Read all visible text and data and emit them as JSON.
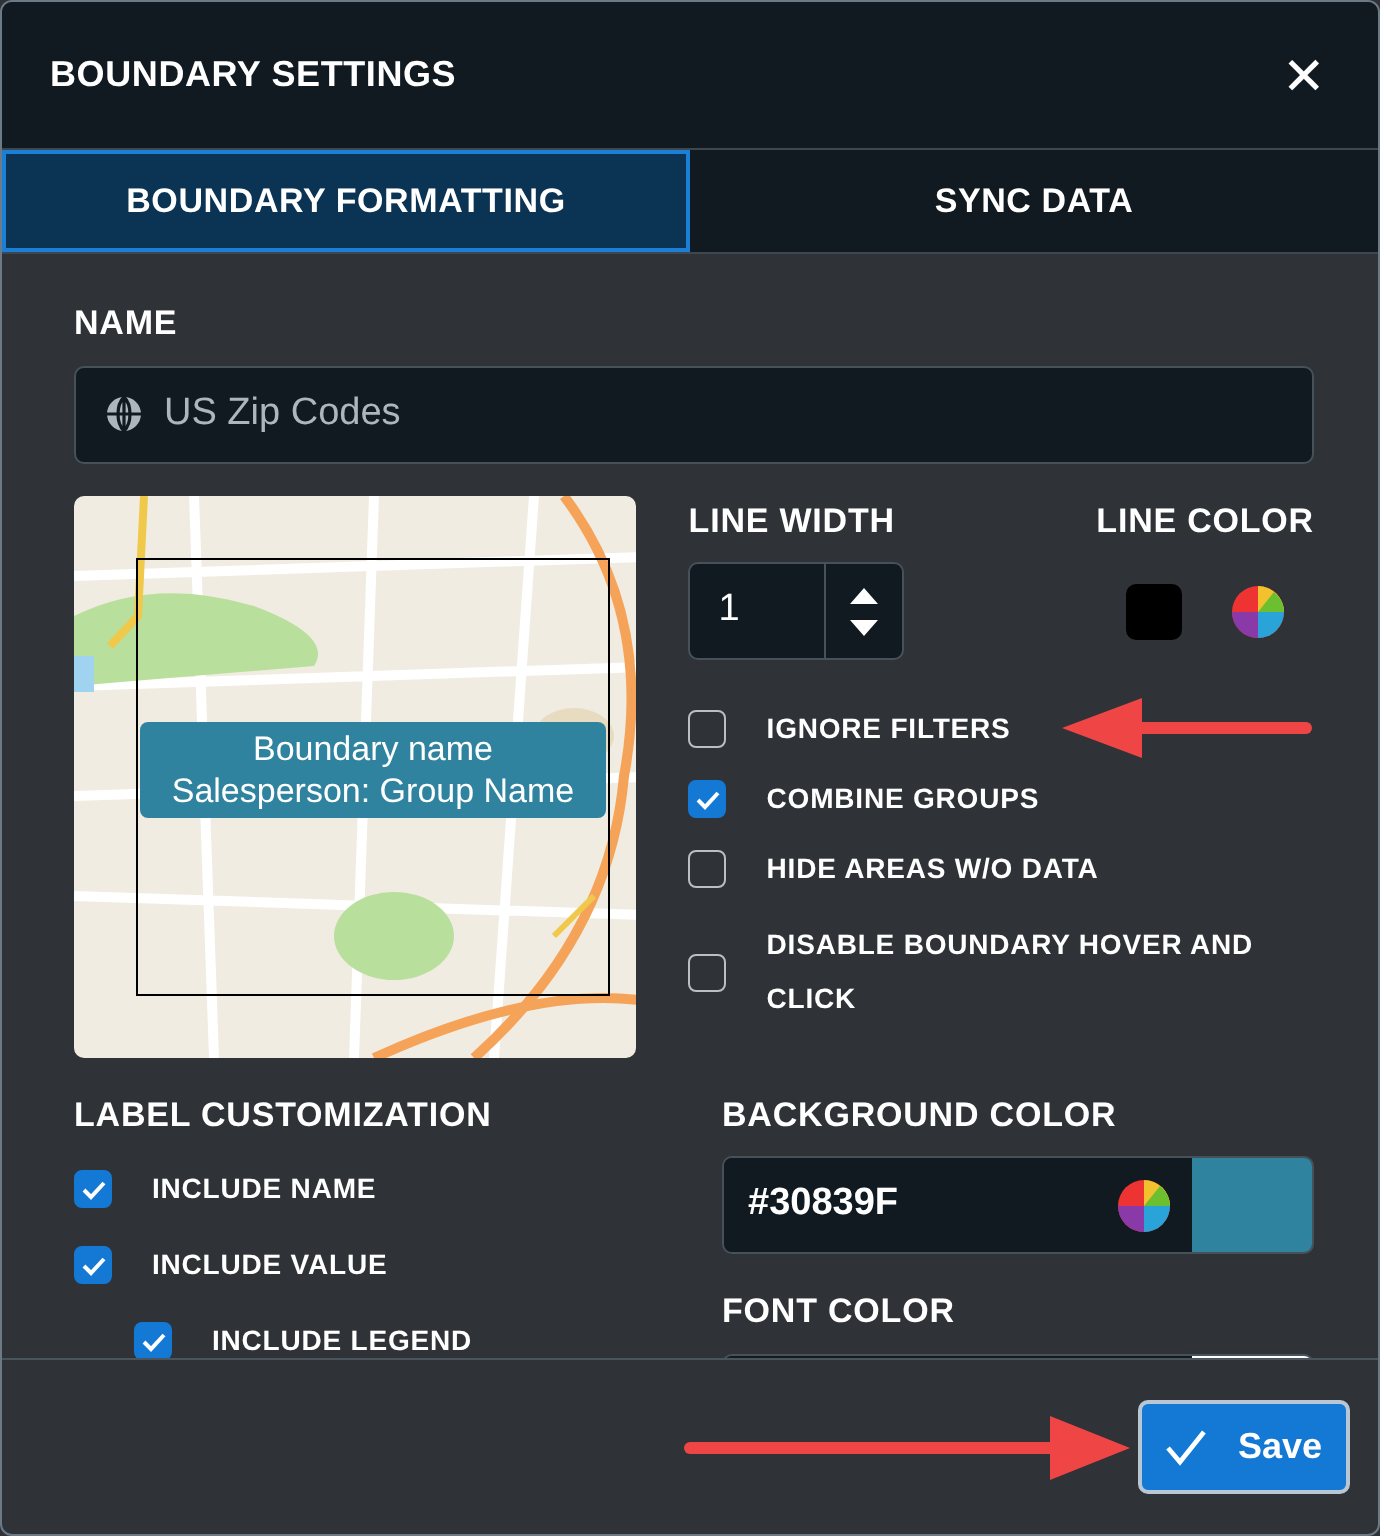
{
  "window": {
    "title": "BOUNDARY SETTINGS",
    "close": "✕"
  },
  "tabs": [
    {
      "label": "BOUNDARY FORMATTING",
      "selected": true
    },
    {
      "label": "SYNC DATA",
      "selected": false
    }
  ],
  "name": {
    "label": "NAME",
    "value": "US Zip Codes"
  },
  "preview": {
    "label_lines": [
      "Boundary name",
      "Salesperson: Group Name"
    ]
  },
  "line_width": {
    "label": "LINE WIDTH",
    "value": "1"
  },
  "line_color": {
    "label": "LINE COLOR",
    "color": "#000000"
  },
  "options": [
    {
      "label": "IGNORE FILTERS",
      "checked": false
    },
    {
      "label": "COMBINE GROUPS",
      "checked": true
    },
    {
      "label": "HIDE AREAS W/O DATA",
      "checked": false
    },
    {
      "label": "DISABLE BOUNDARY HOVER AND CLICK",
      "checked": false
    }
  ],
  "label_customization": {
    "title": "LABEL CUSTOMIZATION",
    "items": [
      {
        "label": "INCLUDE NAME",
        "checked": true
      },
      {
        "label": "INCLUDE VALUE",
        "checked": true,
        "children": [
          {
            "label": "INCLUDE LEGEND",
            "checked": true
          }
        ]
      }
    ]
  },
  "background_color": {
    "label": "BACKGROUND COLOR",
    "value": "#30839F"
  },
  "font_color": {
    "label": "FONT COLOR",
    "color": "#ffffff"
  },
  "save": {
    "label": "Save"
  }
}
